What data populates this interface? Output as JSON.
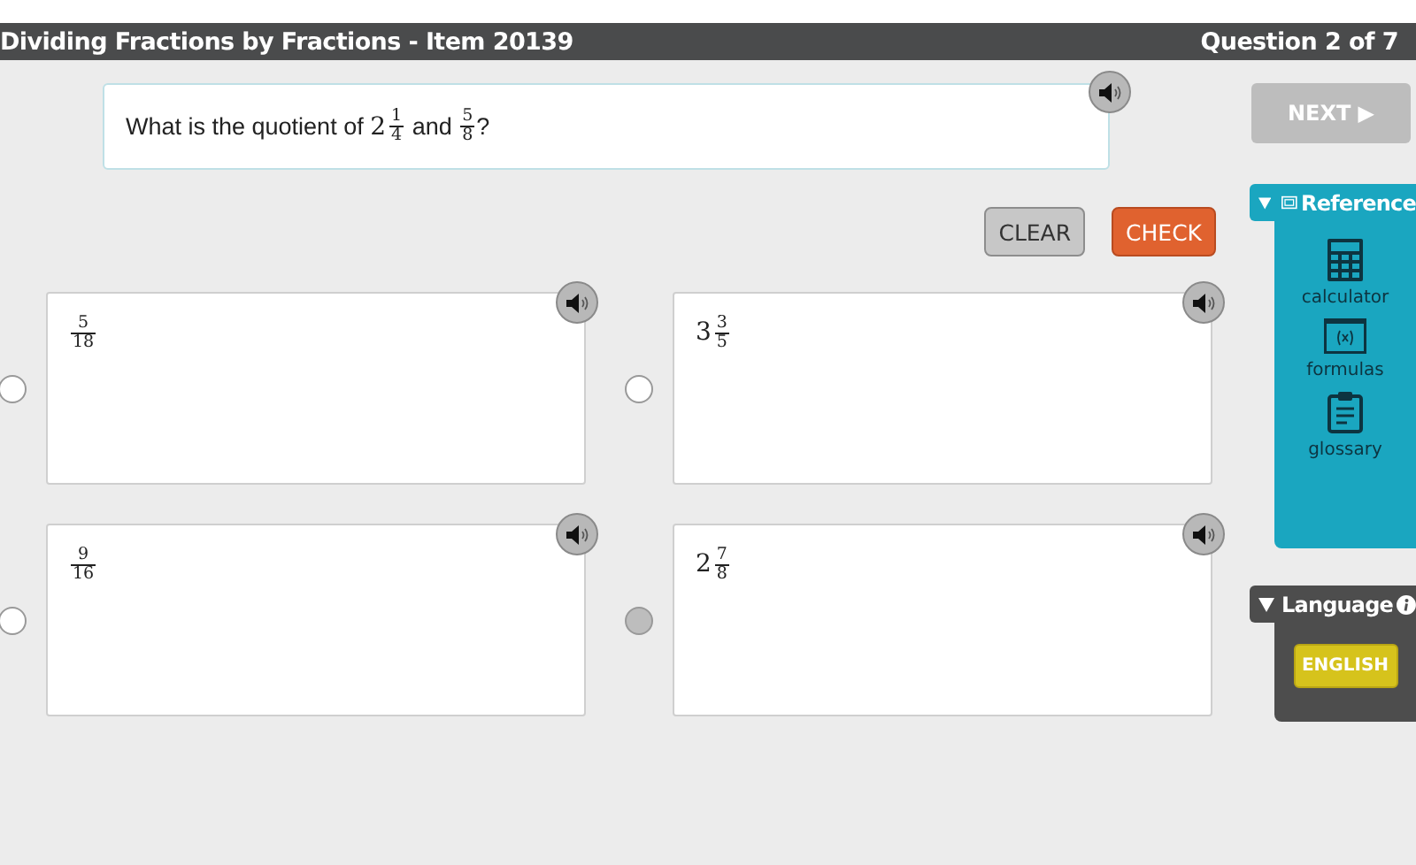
{
  "header": {
    "title": "Dividing Fractions by Fractions - Item 20139",
    "progress": "Question 2 of 7"
  },
  "question": {
    "parts": [
      {
        "kind": "text",
        "text": "What is the quotient of "
      },
      {
        "kind": "fraction",
        "whole": "2",
        "num": "1",
        "den": "4"
      },
      {
        "kind": "text",
        "text": " and "
      },
      {
        "kind": "fraction",
        "num": "5",
        "den": "8"
      },
      {
        "kind": "text",
        "text": "?"
      }
    ]
  },
  "buttons": [
    {
      "label": "CLEAR",
      "kind": "clear"
    },
    {
      "label": "CHECK",
      "kind": "check"
    }
  ],
  "answers": [
    {
      "value": {
        "num": "5",
        "den": "18"
      },
      "selected": false
    },
    {
      "value": {
        "whole": "3",
        "num": "3",
        "den": "5"
      },
      "selected": false
    },
    {
      "value": {
        "num": "9",
        "den": "16"
      },
      "selected": false
    },
    {
      "value": {
        "whole": "2",
        "num": "7",
        "den": "8"
      },
      "selected": true
    }
  ],
  "next": {
    "label": "NEXT ▶",
    "disabled": true
  },
  "reference": {
    "title": "Reference",
    "expanded": true,
    "tools": [
      {
        "kind": "calculator",
        "label": "calculator"
      },
      {
        "kind": "formulas",
        "label": "formulas"
      },
      {
        "kind": "glossary",
        "label": "glossary"
      }
    ]
  },
  "language": {
    "title": "Language",
    "expanded": true,
    "options": [
      {
        "label": "ENGLISH",
        "selected": true
      }
    ]
  }
}
